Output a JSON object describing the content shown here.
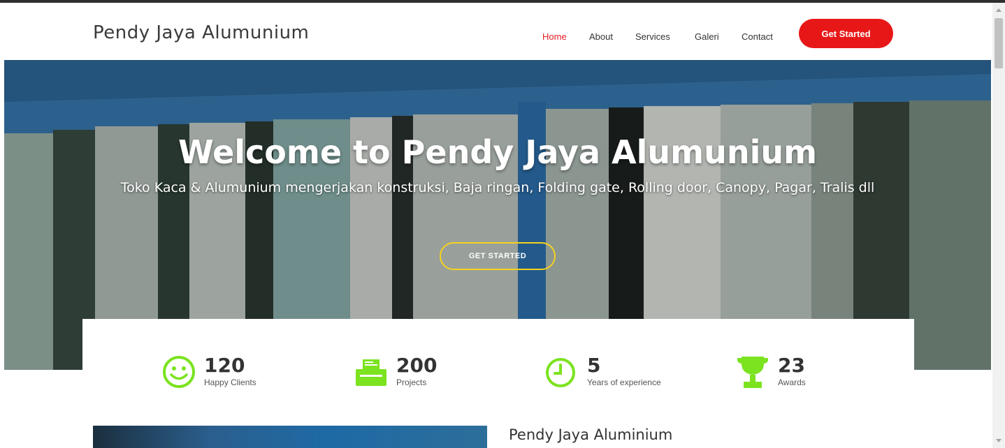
{
  "header": {
    "brand": "Pendy Jaya Alumunium",
    "nav": [
      {
        "label": "Home",
        "active": true
      },
      {
        "label": "About",
        "active": false
      },
      {
        "label": "Services",
        "active": false
      },
      {
        "label": "Galeri",
        "active": false
      },
      {
        "label": "Contact",
        "active": false
      }
    ],
    "cta_label": "Get Started"
  },
  "hero": {
    "title": "Welcome to Pendy Jaya Alumunium",
    "subtitle": "Toko Kaca & Alumunium mengerjakan konstruksi, Baja ringan, Folding gate, Rolling door, Canopy, Pagar, Tralis dll",
    "button_label": "GET STARTED"
  },
  "stats": [
    {
      "icon": "smiley-icon",
      "number": "120",
      "label": "Happy Clients"
    },
    {
      "icon": "printer-icon",
      "number": "200",
      "label": "Projects"
    },
    {
      "icon": "clock-icon",
      "number": "5",
      "label": "Years of experience"
    },
    {
      "icon": "trophy-icon",
      "number": "23",
      "label": "Awards"
    }
  ],
  "about": {
    "title": "Pendy Jaya Aluminium"
  },
  "colors": {
    "accent_red": "#e81717",
    "active_nav": "#e21b23",
    "hero_button_border": "#f5d21e",
    "icon_green": "#7be31f"
  }
}
